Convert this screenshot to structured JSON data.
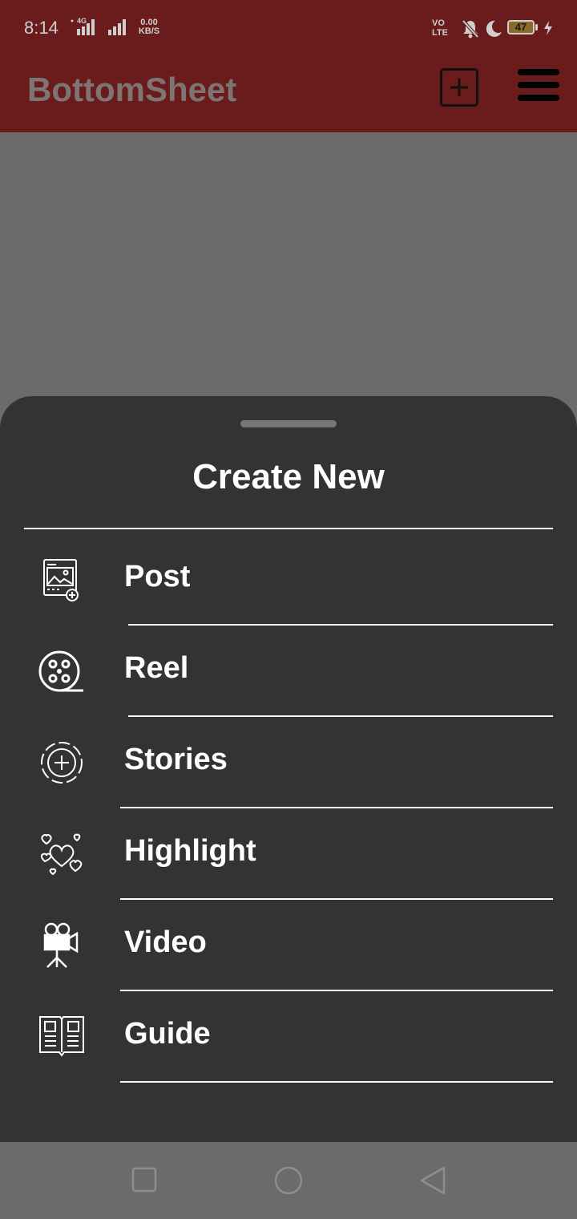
{
  "status_bar": {
    "time": "8:14",
    "network_type": "4G",
    "data_speed_value": "0.00",
    "data_speed_unit": "KB/S",
    "volte_line1": "VO",
    "volte_line2": "LTE",
    "battery_level": "47",
    "icons": [
      "signal-icon",
      "signal-icon",
      "volte-icon",
      "mute-bell-icon",
      "moon-icon",
      "battery-icon",
      "charging-icon"
    ]
  },
  "app_bar": {
    "title": "BottomSheet",
    "actions": [
      "add-box-icon",
      "menu-icon"
    ]
  },
  "sheet": {
    "title": "Create New",
    "items": [
      {
        "label": "Post",
        "icon": "post-image-add-icon"
      },
      {
        "label": "Reel",
        "icon": "film-reel-icon"
      },
      {
        "label": "Stories",
        "icon": "story-add-icon"
      },
      {
        "label": "Highlight",
        "icon": "hearts-icon"
      },
      {
        "label": "Video",
        "icon": "video-camera-icon"
      },
      {
        "label": "Guide",
        "icon": "guide-book-icon"
      }
    ]
  },
  "nav_bar": {
    "buttons": [
      "recents-square-icon",
      "home-circle-icon",
      "back-triangle-icon"
    ]
  },
  "colors": {
    "app_bar": "#6a1c1c",
    "sheet_background": "#333333",
    "scrim": "#6b6b6b",
    "text_primary": "#ffffff"
  }
}
